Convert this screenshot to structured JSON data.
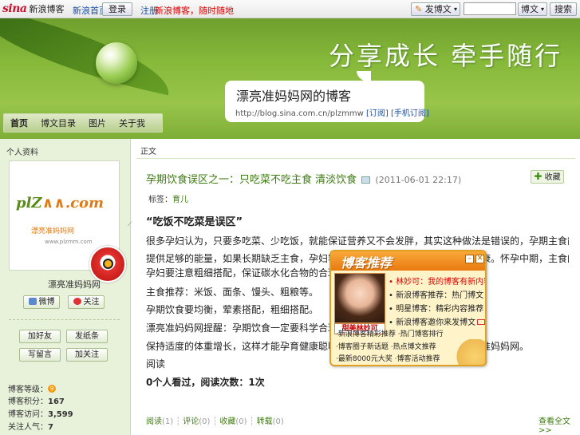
{
  "topbar": {
    "logo_brand": "sina",
    "logo_text": "新浪博客",
    "link_1": "新浪首页",
    "btn_1": "登录",
    "link_2": "注册",
    "link_3": "新浪博客，随时随地",
    "write_label": "发博文",
    "search_select": "博文",
    "search_button": "搜索"
  },
  "banner": {
    "slogan": "分享成长 牵手随行",
    "blog_title": "漂亮准妈妈网的博客",
    "url": "http://blog.sina.com.cn/plzmmw",
    "url_link_1": "[订阅]",
    "url_link_2": "[手机订阅]",
    "nav": [
      "首页",
      "博文目录",
      "图片",
      "关于我"
    ]
  },
  "left": {
    "section_title": "个人资料",
    "logo_text_a": "plZ",
    "logo_text_b": ".com",
    "logo_sub": "漂亮准妈妈网",
    "logo_url": "www.plzmm.com",
    "user_name": "漂亮准妈妈网",
    "btn_weibo": "微博",
    "btn_qq": "关注",
    "btn_add_friend": "加好友",
    "btn_message": "发纸条",
    "btn_comment": "写留言",
    "btn_follow": "加关注",
    "stats": [
      {
        "label": "博客等级：",
        "value": "9"
      },
      {
        "label": "博客积分：",
        "value": "167"
      },
      {
        "label": "博客访问：",
        "value": "3,599"
      },
      {
        "label": "关注人气：",
        "value": "7"
      }
    ]
  },
  "main": {
    "heading": "正文",
    "post_title": "孕期饮食误区之一：只吃菜不吃主食 清淡饮食",
    "post_time": "(2011-06-01 22:17)",
    "fav_label": "收藏",
    "tag_label": "标签：",
    "tag_value": "育儿",
    "quote": "“吃饭不吃菜是误区”",
    "lines": [
      "很多孕妇认为，只要多吃菜、少吃饭，就能保证营养又不会发胖，其实这种做法是错误的，孕期主食能够为胎儿的生长发育",
      "提供足够的能量，如果长期缺乏主食，孕妇容易出现低血糖等问题，影响母婴健康。怀孕中期，主食的需求量逐渐增加，",
      "孕妇要注意粗细搭配，保证碳水化合物的合理摄入，不能只吃菜不吃主食。",
      "主食推荐：米饭、面条、馒头、粗粮等。",
      "孕期饮食要均衡，荤素搭配，粗细搭配。",
      "漂亮准妈妈网提醒：孕期饮食一定要科学合理，不要盲目节食，也不要暴饮暴食，",
      "保持适度的体重增长，这样才能孕育健康聪明的宝宝。更多孕期知识请访问漂亮准妈妈网。",
      "阅读"
    ],
    "read_count_line": "0个人看过，阅读次数：1次",
    "footer": [
      {
        "label": "阅读",
        "count": "(1)"
      },
      {
        "label": "评论",
        "count": "(0)"
      },
      {
        "label": "收藏",
        "count": "(0)"
      },
      {
        "label": "转载",
        "count": "(0)"
      }
    ],
    "read_more": "查看全文>>"
  },
  "popup": {
    "title": "博客推荐",
    "caption": "甜美林妙可",
    "items": [
      "林妙可：我的博客有新内容",
      "新浪博客推荐：热门博文",
      "明星博客：精彩内容推荐",
      "新浪博客邀你来发博文"
    ],
    "lines": [
      "·新浪博客精彩推荐 ·热门博客排行",
      "·博客圈子新话题 ·热点博文推荐",
      "·最新8000元大奖 ·博客活动推荐"
    ]
  }
}
